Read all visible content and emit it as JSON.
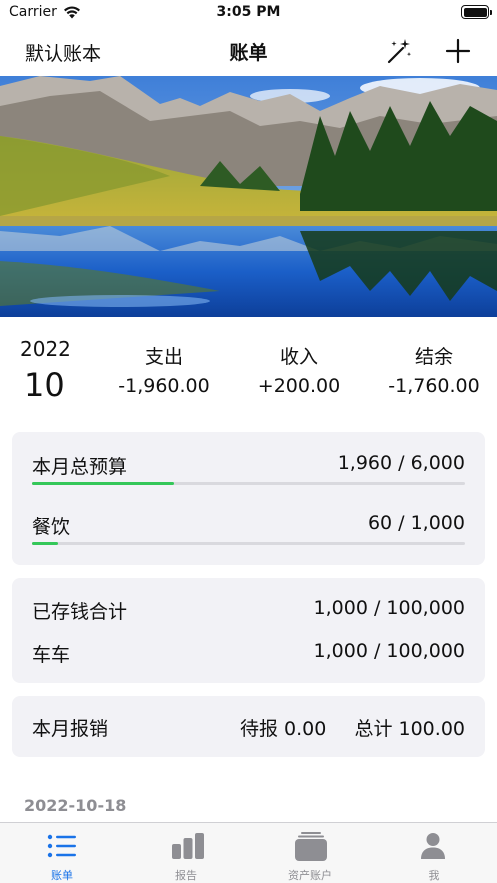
{
  "status_bar": {
    "carrier": "Carrier",
    "time": "3:05 PM"
  },
  "nav": {
    "left_title": "默认账本",
    "title": "账单"
  },
  "summary": {
    "year": "2022",
    "month": "10",
    "expense_label": "支出",
    "expense_value": "-1,960.00",
    "income_label": "收入",
    "income_value": "+200.00",
    "balance_label": "结余",
    "balance_value": "-1,760.00"
  },
  "budget_card": {
    "items": [
      {
        "label": "本月总预算",
        "value": "1,960 / 6,000",
        "progress": 0.327
      },
      {
        "label": "餐饮",
        "value": "60 / 1,000",
        "progress": 0.06
      }
    ]
  },
  "savings_card": {
    "items": [
      {
        "label": "已存钱合计",
        "value": "1,000 / 100,000"
      },
      {
        "label": "车车",
        "value": "1,000 / 100,000"
      }
    ]
  },
  "reimburse_card": {
    "label": "本月报销",
    "pending": "待报 0.00",
    "total": "总计 100.00"
  },
  "list": {
    "date": "2022-10-18"
  },
  "tabs": [
    {
      "label": "账单",
      "active": true
    },
    {
      "label": "报告",
      "active": false
    },
    {
      "label": "资产账户",
      "active": false
    },
    {
      "label": "我",
      "active": false
    }
  ],
  "colors": {
    "accent": "#1a73e8",
    "progress": "#34c759",
    "card_bg": "#f2f2f6",
    "muted": "#8e8e93"
  }
}
